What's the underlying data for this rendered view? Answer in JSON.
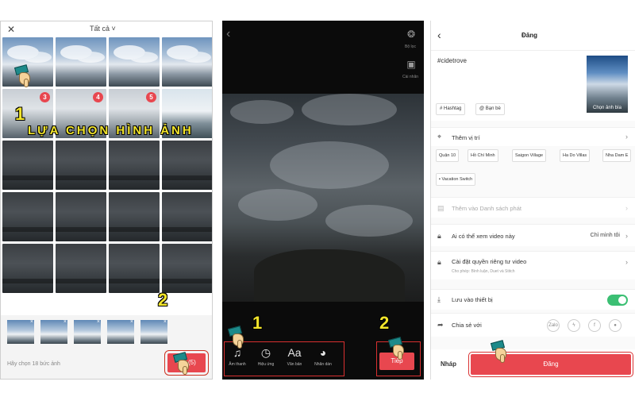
{
  "panel1": {
    "title": "Tất cả",
    "close_glyph": "✕",
    "badges": [
      "3",
      "4",
      "5"
    ],
    "step1": "1",
    "step2": "2",
    "caption": "LỰA CHỌN HÌNH ẢNH",
    "selected_thumbs": [
      "",
      "",
      "",
      "",
      ""
    ],
    "hint": "Hãy chọn 18 bức ảnh",
    "ok_label": "OK (5)"
  },
  "panel2": {
    "back_glyph": "‹",
    "side_tools": [
      {
        "label": "Bộ lọc",
        "icon": "filter-icon"
      },
      {
        "label": "Cài nhãn",
        "icon": "image-icon"
      }
    ],
    "tools": [
      {
        "label": "Âm thanh",
        "glyph": "♫",
        "icon": "music-icon"
      },
      {
        "label": "Hiệu ứng",
        "glyph": "◷",
        "icon": "effects-icon"
      },
      {
        "label": "Văn bản",
        "glyph": "Aa",
        "icon": "text-icon"
      },
      {
        "label": "Nhãn dán",
        "glyph": "◕",
        "icon": "sticker-icon"
      }
    ],
    "step1": "1",
    "step2": "2",
    "next_label": "Tiếp"
  },
  "panel3": {
    "title": "Đăng",
    "back_glyph": "‹",
    "caption_text": "#cidetrove",
    "cover_label": "Chọn ảnh bìa",
    "chips": [
      "# Hashtag",
      "@ Bạn bè"
    ],
    "location_label": "Thêm vị trí",
    "locations": [
      "Quận 10",
      "Hồ Chí Minh",
      "Saigon Village",
      "Ha Do Villas",
      "Nha Dam E"
    ],
    "vacation_tag": "Vacation Switch",
    "playlist_label": "Thêm vào Danh sách phát",
    "who_can_view_label": "Ai có thể xem video này",
    "who_can_view_value": "Chỉ mình tôi",
    "privacy_label": "Cài đặt quyền riêng tư video",
    "privacy_sub": "Cho phép: Bình luận, Duet và Stitch",
    "save_device_label": "Lưu vào thiết bị",
    "save_device_on": true,
    "share_label": "Chia sẻ với",
    "share_targets": [
      "Zalo",
      "Messenger",
      "Facebook",
      "Message"
    ],
    "draft_label": "Nháp",
    "post_label": "Đăng"
  },
  "colors": {
    "accent": "#e8474f",
    "step_yellow": "#f2e52b",
    "toggle_on": "#3bbf73",
    "highlight_box": "#d93030"
  }
}
